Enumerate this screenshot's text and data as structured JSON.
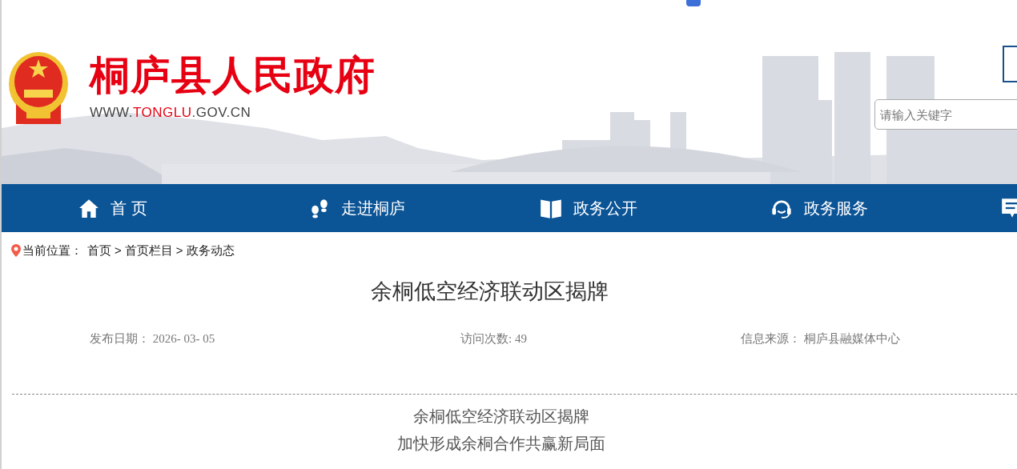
{
  "site": {
    "title": "桐庐县人民政府",
    "url_prefix": "WWW.",
    "url_highlight": "TONGLU",
    "url_suffix": ".GOV.CN"
  },
  "search": {
    "placeholder": "请输入关键字"
  },
  "nav": [
    {
      "kind": "home",
      "label": "首 页"
    },
    {
      "kind": "footsteps",
      "label": "走进桐庐"
    },
    {
      "kind": "book",
      "label": "政务公开"
    },
    {
      "kind": "headset",
      "label": "政务服务"
    },
    {
      "kind": "message"
    }
  ],
  "breadcrumb": {
    "label": "当前位置：",
    "items": [
      "首页",
      "首页栏目",
      "政务动态"
    ],
    "separator": ">"
  },
  "article": {
    "title": "余桐低空经济联动区揭牌",
    "meta": [
      {
        "label": "发布日期：",
        "value": "2026- 03- 05"
      },
      {
        "label": "访问次数:",
        "value": "49"
      },
      {
        "label": "信息来源：",
        "value": "桐庐县融媒体中心"
      }
    ],
    "headings": [
      "余桐低空经济联动区揭牌",
      "加快形成余桐合作共赢新局面"
    ]
  }
}
